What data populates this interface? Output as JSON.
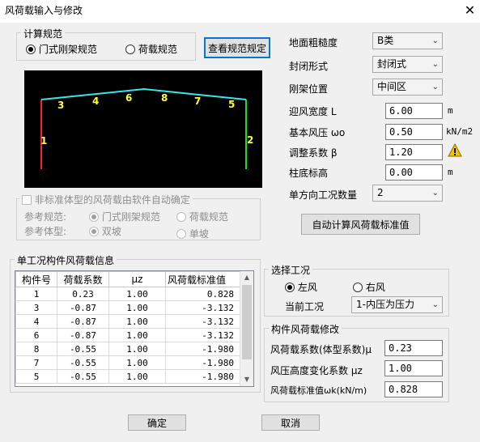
{
  "window": {
    "title": "风荷载输入与修改",
    "close": "✕"
  },
  "calc_spec": {
    "label": "计算规范",
    "options": [
      "门式刚架规范",
      "荷载规范"
    ],
    "selected": 0,
    "view_button": "查看规范规定"
  },
  "frame_view": {
    "member_labels": [
      "1",
      "3",
      "4",
      "6",
      "8",
      "7",
      "5",
      "2"
    ],
    "colors": {
      "background": "#000000",
      "left_column": "#ff2020",
      "right_column": "#20e020",
      "rafter": "#33e6f0",
      "label": "#ffff33"
    }
  },
  "params": {
    "terrain_roughness": {
      "label": "地面粗糙度",
      "value": "B类"
    },
    "enclosure_type": {
      "label": "封闭形式",
      "value": "封闭式"
    },
    "frame_position": {
      "label": "刚架位置",
      "value": "中间区"
    },
    "windward_width": {
      "label": "迎风宽度 L",
      "value": "6.00",
      "unit": "m"
    },
    "basic_pressure": {
      "label": "基本风压 ωo",
      "value": "0.50",
      "unit": "kN/m2"
    },
    "adjust_factor": {
      "label": "调整系数 β",
      "value": "1.20"
    },
    "column_base_elev": {
      "label": "柱底标高",
      "value": "0.00",
      "unit": "m"
    },
    "one_dir_case_count": {
      "label": "单方向工况数量",
      "value": "2"
    }
  },
  "nonstandard": {
    "checkbox_label": "非标准体型的风荷载由软件自动确定",
    "ref_spec_label": "参考规范:",
    "ref_spec_options": [
      "门式刚架规范",
      "荷载规范"
    ],
    "ref_shape_label": "参考体型:",
    "ref_shape_options": [
      "双坡",
      "单坡"
    ]
  },
  "auto_calc_button": "自动计算风荷载标准值",
  "single_case": {
    "label": "单工况构件风荷载信息",
    "columns": [
      "构件号",
      "荷载系数",
      "μz",
      "风荷载标准值"
    ],
    "rows": [
      [
        "1",
        "0.23",
        "1.00",
        "0.828"
      ],
      [
        "3",
        "-0.87",
        "1.00",
        "-3.132"
      ],
      [
        "4",
        "-0.87",
        "1.00",
        "-3.132"
      ],
      [
        "6",
        "-0.87",
        "1.00",
        "-3.132"
      ],
      [
        "8",
        "-0.55",
        "1.00",
        "-1.980"
      ],
      [
        "7",
        "-0.55",
        "1.00",
        "-1.980"
      ],
      [
        "5",
        "-0.55",
        "1.00",
        "-1.980"
      ]
    ]
  },
  "select_case": {
    "label": "选择工况",
    "options": [
      "左风",
      "右风"
    ],
    "selected": 0,
    "current_label": "当前工况",
    "current_value": "1-内压为压力"
  },
  "member_edit": {
    "label": "构件风荷载修改",
    "shape_coef": {
      "label": "风荷载系数(体型系数)μ",
      "value": "0.23"
    },
    "height_coef": {
      "label": "风压高度变化系数 μz",
      "value": "1.00"
    },
    "std_value": {
      "label": "风荷载标准值ωk(kN/m)",
      "value": "0.828"
    }
  },
  "footer": {
    "ok": "确定",
    "cancel": "取消"
  },
  "colors": {
    "focus_border": "#0078d7",
    "warning": "#f5c400"
  }
}
